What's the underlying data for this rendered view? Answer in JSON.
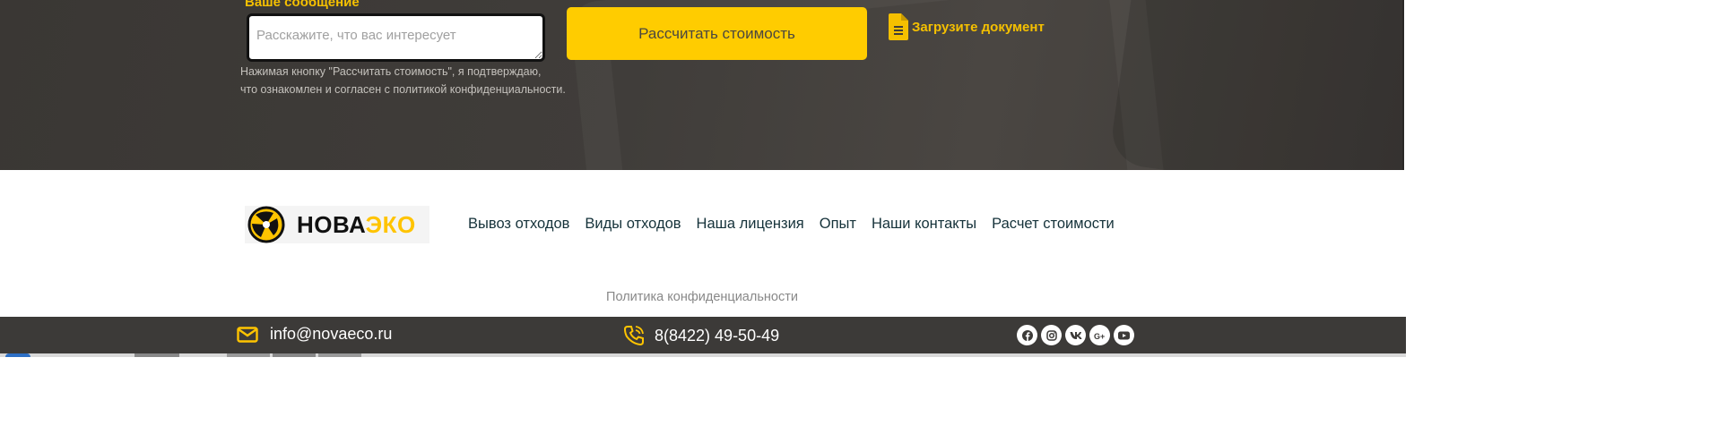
{
  "form": {
    "message_label": "Ваше сообщение",
    "message_placeholder": "Расскажите, что вас интересует",
    "submit_label": "Рассчитать стоимость",
    "upload_label": "Загрузите документ",
    "consent_line1": "Нажимая кнопку \"Рассчитать стоимость\", я подтверждаю,",
    "consent_line2": "что ознакомлен и согласен с политикой конфиденциальности."
  },
  "footer": {
    "logo": {
      "part1": "НОВА",
      "part2": "ЭКО"
    },
    "nav": [
      "Вывоз отходов",
      "Виды отходов",
      "Наша лицензия",
      "Опыт",
      "Наши контакты",
      "Расчет стоимости"
    ],
    "policy_link": "Политика конфиденциальности"
  },
  "contact_bar": {
    "email": "info@novaeco.ru",
    "phone": "8(8422) 49-50-49",
    "socials": [
      "facebook-icon",
      "instagram-icon",
      "vk-icon",
      "google-plus-icon",
      "youtube-icon"
    ]
  },
  "colors": {
    "accent": "#ffcc00",
    "dark_band": "#3f3c39",
    "bar": "#3c3a38",
    "nav_text": "#15323a"
  }
}
